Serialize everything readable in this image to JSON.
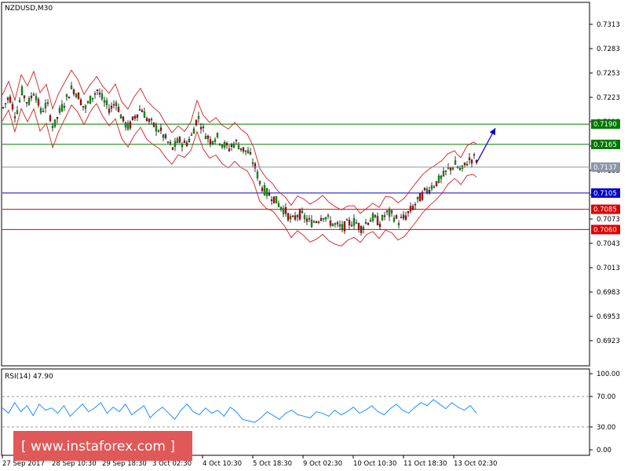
{
  "chart_data": {
    "type": "candlestick",
    "title": "NZDUSD,M30",
    "y_ticks": [
      "0.7313",
      "0.7283",
      "0.7253",
      "0.7223",
      "0.7193",
      "0.7163",
      "0.7133",
      "0.7103",
      "0.7073",
      "0.7043",
      "0.7013",
      "0.6983",
      "0.6953",
      "0.6923"
    ],
    "x_ticks": [
      "27 Sep 2017",
      "28 Sep 10:30",
      "29 Sep 18:30",
      "3 Oct 02:30",
      "4 Oct 10:30",
      "5 Oct 18:30",
      "9 Oct 02:30",
      "10 Oct 10:30",
      "11 Oct 18:30",
      "13 Oct 02:30"
    ],
    "current_price": "0.7137",
    "levels": [
      {
        "value": "0.7190",
        "color": "#007700",
        "label_bg": "#007700"
      },
      {
        "value": "0.7165",
        "color": "#007700",
        "label_bg": "#007700"
      },
      {
        "value": "0.7105",
        "color": "#0000cc",
        "label_bg": "#0000cc"
      },
      {
        "value": "0.7085",
        "color": "#dd0000",
        "label_bg": "#dd0000"
      },
      {
        "value": "0.7060",
        "color": "#dd0000",
        "label_bg": "#dd0000"
      }
    ],
    "price_path": [
      [
        0,
        0.721
      ],
      [
        8,
        0.7225
      ],
      [
        16,
        0.72
      ],
      [
        24,
        0.723
      ],
      [
        32,
        0.7215
      ],
      [
        40,
        0.7232
      ],
      [
        48,
        0.7205
      ],
      [
        56,
        0.7215
      ],
      [
        64,
        0.7185
      ],
      [
        72,
        0.7205
      ],
      [
        80,
        0.722
      ],
      [
        88,
        0.7235
      ],
      [
        96,
        0.7225
      ],
      [
        104,
        0.7208
      ],
      [
        112,
        0.7222
      ],
      [
        120,
        0.7232
      ],
      [
        128,
        0.7218
      ],
      [
        136,
        0.7208
      ],
      [
        144,
        0.7218
      ],
      [
        152,
        0.7195
      ],
      [
        160,
        0.7185
      ],
      [
        168,
        0.72
      ],
      [
        176,
        0.721
      ],
      [
        184,
        0.7195
      ],
      [
        192,
        0.7188
      ],
      [
        200,
        0.7182
      ],
      [
        208,
        0.717
      ],
      [
        216,
        0.716
      ],
      [
        224,
        0.717
      ],
      [
        232,
        0.7165
      ],
      [
        240,
        0.7175
      ],
      [
        248,
        0.72
      ],
      [
        256,
        0.718
      ],
      [
        264,
        0.717
      ],
      [
        272,
        0.7175
      ],
      [
        280,
        0.7165
      ],
      [
        288,
        0.716
      ],
      [
        296,
        0.7168
      ],
      [
        304,
        0.716
      ],
      [
        312,
        0.7155
      ],
      [
        320,
        0.714
      ],
      [
        328,
        0.7115
      ],
      [
        336,
        0.7105
      ],
      [
        344,
        0.71
      ],
      [
        352,
        0.709
      ],
      [
        360,
        0.7082
      ],
      [
        368,
        0.707
      ],
      [
        376,
        0.708
      ],
      [
        384,
        0.7075
      ],
      [
        392,
        0.7068
      ],
      [
        400,
        0.7072
      ],
      [
        408,
        0.7078
      ],
      [
        416,
        0.707
      ],
      [
        424,
        0.7065
      ],
      [
        432,
        0.7062
      ],
      [
        440,
        0.7068
      ],
      [
        448,
        0.707
      ],
      [
        456,
        0.7062
      ],
      [
        464,
        0.707
      ],
      [
        472,
        0.7075
      ],
      [
        480,
        0.7068
      ],
      [
        488,
        0.708
      ],
      [
        496,
        0.7078
      ],
      [
        504,
        0.707
      ],
      [
        512,
        0.7075
      ],
      [
        520,
        0.7085
      ],
      [
        528,
        0.7095
      ],
      [
        536,
        0.7105
      ],
      [
        544,
        0.7112
      ],
      [
        552,
        0.7118
      ],
      [
        560,
        0.7125
      ],
      [
        568,
        0.7135
      ],
      [
        576,
        0.714
      ],
      [
        584,
        0.7132
      ],
      [
        592,
        0.7145
      ],
      [
        600,
        0.7148
      ],
      [
        604,
        0.7145
      ]
    ],
    "projection_arrow": {
      "from": [
        604,
        0.7142
      ],
      "to": [
        628,
        0.7185
      ]
    },
    "rsi": {
      "label": "RSI(14) 47.90",
      "y_ticks": [
        "100.00",
        "70.00",
        "30.00",
        "0.00"
      ],
      "levels": [
        70,
        30
      ],
      "values": [
        55,
        48,
        62,
        50,
        58,
        45,
        60,
        52,
        55,
        48,
        58,
        44,
        52,
        60,
        50,
        55,
        62,
        48,
        56,
        50,
        60,
        46,
        52,
        58,
        42,
        50,
        56,
        48,
        40,
        52,
        60,
        50,
        46,
        55,
        48,
        52,
        44,
        56,
        50,
        40,
        38,
        36,
        42,
        50,
        45,
        40,
        48,
        52,
        46,
        44,
        42,
        50,
        48,
        44,
        52,
        46,
        50,
        56,
        48,
        52,
        58,
        50,
        46,
        54,
        60,
        52,
        48,
        56,
        62,
        58,
        66,
        60,
        54,
        62,
        56,
        52,
        58,
        48
      ]
    }
  },
  "watermark": {
    "text": "[ www.instaforex.com ]",
    "bg_color": "#e05858"
  }
}
